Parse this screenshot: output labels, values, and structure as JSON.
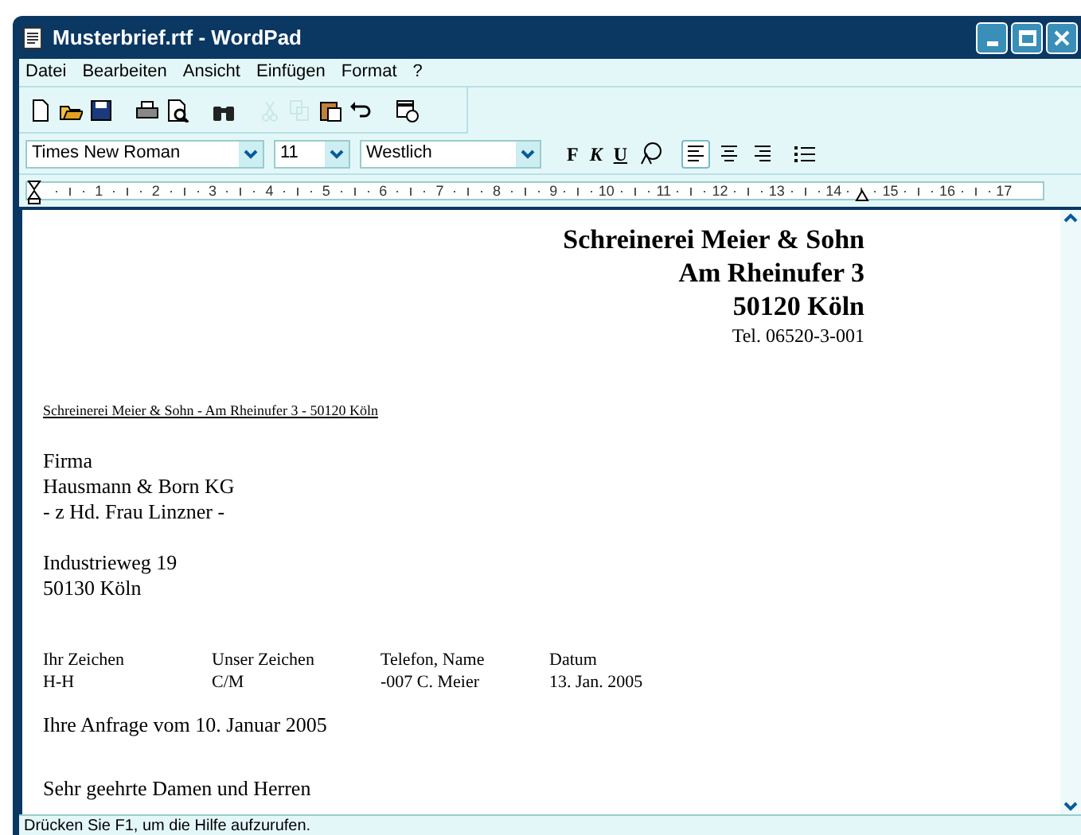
{
  "window": {
    "title": "Musterbrief.rtf - WordPad"
  },
  "menu": [
    "Datei",
    "Bearbeiten",
    "Ansicht",
    "Einfügen",
    "Format",
    "?"
  ],
  "toolbar": [
    {
      "kind": "new",
      "disabled": false
    },
    {
      "kind": "open",
      "disabled": false
    },
    {
      "kind": "save",
      "disabled": false
    },
    {
      "kind": "sep"
    },
    {
      "kind": "print",
      "disabled": false
    },
    {
      "kind": "preview",
      "disabled": false
    },
    {
      "kind": "sep"
    },
    {
      "kind": "find",
      "disabled": false
    },
    {
      "kind": "sep"
    },
    {
      "kind": "cut",
      "disabled": true
    },
    {
      "kind": "copy",
      "disabled": true
    },
    {
      "kind": "paste",
      "disabled": false
    },
    {
      "kind": "undo",
      "disabled": false
    },
    {
      "kind": "sep"
    },
    {
      "kind": "datetime",
      "disabled": false
    }
  ],
  "format_bar": {
    "font": "Times New Roman",
    "size": "11",
    "script": "Westlich",
    "styles": [
      {
        "kind": "bold",
        "label": "F"
      },
      {
        "kind": "italic",
        "label": "K"
      },
      {
        "kind": "underline",
        "label": "U"
      },
      {
        "kind": "color"
      }
    ],
    "align": [
      {
        "kind": "left",
        "selected": true
      },
      {
        "kind": "center",
        "selected": false
      },
      {
        "kind": "right",
        "selected": false
      }
    ]
  },
  "ruler": [
    "1",
    "2",
    "3",
    "4",
    "5",
    "6",
    "7",
    "8",
    "9",
    "10",
    "11",
    "12",
    "13",
    "14",
    "15",
    "16",
    "17"
  ],
  "document": {
    "letterhead": [
      "Schreinerei Meier & Sohn",
      "Am Rheinufer 3",
      "50120 Köln"
    ],
    "phone": "Tel. 06520-3-001",
    "sender_line": "Schreinerei Meier & Sohn - Am Rheinufer 3 - 50120 Köln",
    "address": [
      [
        "Firma",
        "Hausmann & Born KG",
        "- z Hd. Frau Linzner -"
      ],
      [
        "Industrieweg 19",
        "50130 Köln"
      ]
    ],
    "references": [
      {
        "label": "Ihr Zeichen",
        "value": "H-H"
      },
      {
        "label": "Unser Zeichen",
        "value": "C/M"
      },
      {
        "label": "Telefon, Name",
        "value": "-007 C. Meier"
      },
      {
        "label": "Datum",
        "value": "13. Jan. 2005"
      }
    ],
    "subject": "Ihre Anfrage vom 10. Januar 2005",
    "salutation": "Sehr geehrte Damen und Herren"
  },
  "status_bar": "Drücken Sie F1, um die Hilfe aufzurufen."
}
